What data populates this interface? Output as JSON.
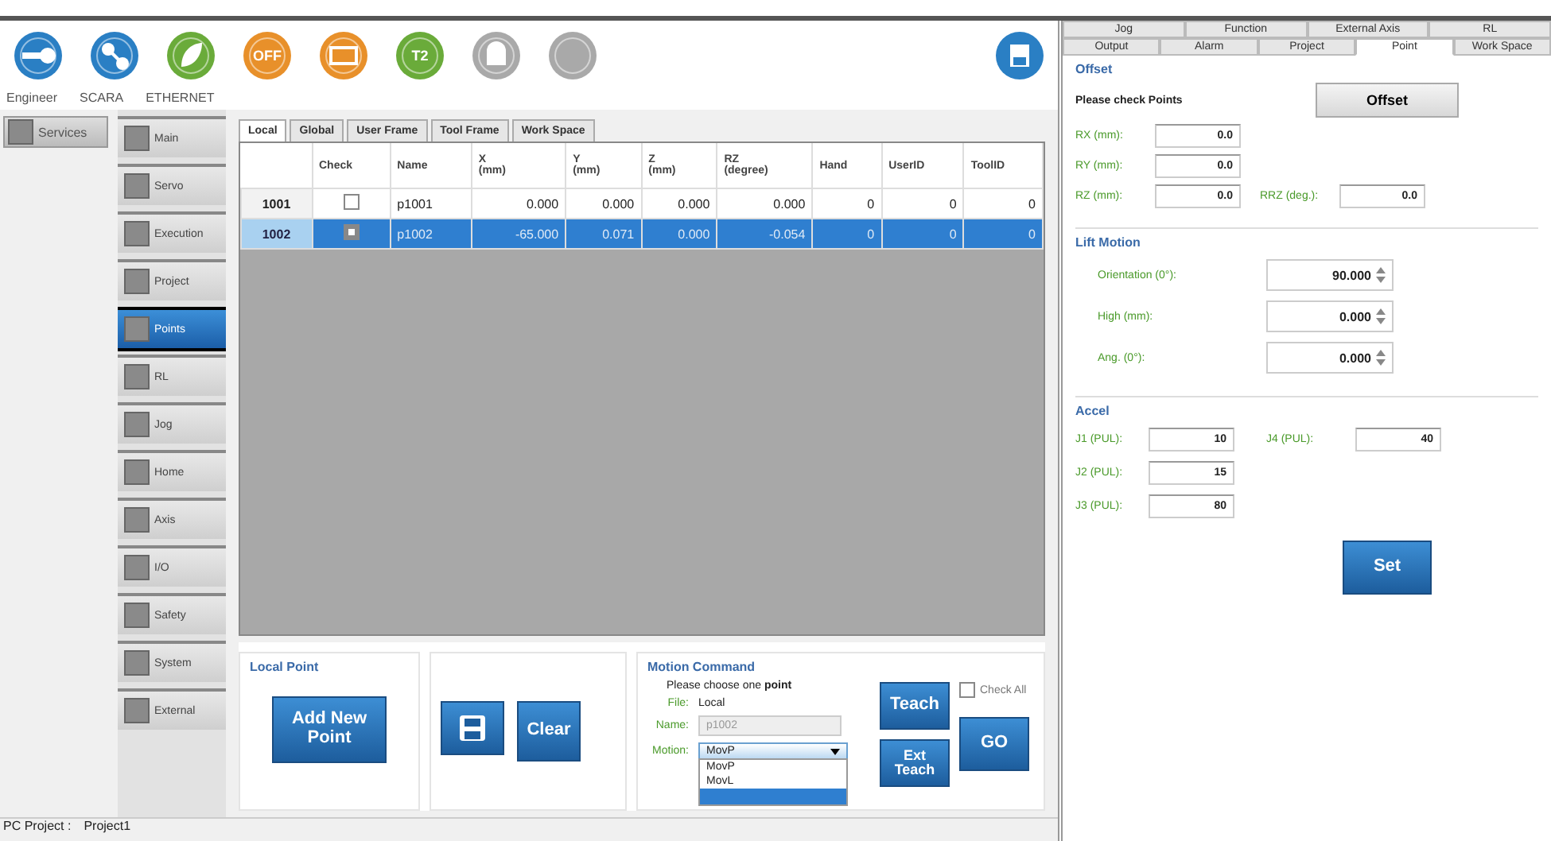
{
  "toolbar": {
    "icons": [
      {
        "kind": "key",
        "color": "#2a7fc4"
      },
      {
        "kind": "network",
        "color": "#2a7fc4"
      },
      {
        "kind": "leaf",
        "color": "#6aab3a"
      },
      {
        "kind": "text",
        "color": "#e8902a",
        "text": "OFF"
      },
      {
        "kind": "card",
        "color": "#e8902a"
      },
      {
        "kind": "text",
        "color": "#6aab3a",
        "text": "T2"
      },
      {
        "kind": "bell",
        "color": "#a9a9a9"
      },
      {
        "kind": "plain",
        "color": "#a9a9a9"
      }
    ],
    "labels": [
      "Engineer",
      "SCARA",
      "ETHERNET"
    ]
  },
  "services": "Services",
  "nav": [
    {
      "label": "Main",
      "selected": false
    },
    {
      "label": "Servo",
      "selected": false
    },
    {
      "label": "Execution",
      "selected": false
    },
    {
      "label": "Project",
      "selected": false
    },
    {
      "label": "Points",
      "selected": true
    },
    {
      "label": "RL",
      "selected": false
    },
    {
      "label": "Jog",
      "selected": false
    },
    {
      "label": "Home",
      "selected": false
    },
    {
      "label": "Axis",
      "selected": false
    },
    {
      "label": "I/O",
      "selected": false
    },
    {
      "label": "Safety",
      "selected": false
    },
    {
      "label": "System",
      "selected": false
    },
    {
      "label": "External",
      "selected": false
    }
  ],
  "tabs": [
    {
      "label": "Local",
      "selected": true
    },
    {
      "label": "Global",
      "selected": false
    },
    {
      "label": "User Frame",
      "selected": false
    },
    {
      "label": "Tool Frame",
      "selected": false
    },
    {
      "label": "Work Space",
      "selected": false
    }
  ],
  "table": {
    "columns": [
      "",
      "Check",
      "Name",
      "X\n(mm)",
      "Y\n(mm)",
      "Z\n(mm)",
      "RZ\n(degree)",
      "Hand",
      "UserID",
      "ToolID"
    ],
    "rows": [
      {
        "checked": false,
        "selected": false,
        "cells": [
          "1001",
          "",
          "p1001",
          "0.000",
          "0.000",
          "0.000",
          "0.000",
          "0",
          "0",
          "0"
        ]
      },
      {
        "checked": true,
        "selected": true,
        "cells": [
          "1002",
          "",
          "p1002",
          "-65.000",
          "0.071",
          "0.000",
          "-0.054",
          "0",
          "0",
          "0"
        ]
      }
    ]
  },
  "local_point": {
    "title": "Local Point",
    "add_button": "Add New Point",
    "clear_button": "Clear"
  },
  "motion": {
    "title": "Motion Command",
    "hint": "Please choose one **point**",
    "file_label": "File:",
    "file_value": "Local",
    "name_label": "Name:",
    "name_value": "p1002",
    "motion_label": "Motion:",
    "motion_value": "MovP",
    "options": [
      {
        "label": "MovP",
        "selected": false
      },
      {
        "label": "MovL",
        "selected": false
      }
    ],
    "teach": "Teach",
    "ext_teach": "Ext\nTeach",
    "check_all": {
      "label": "Check All",
      "checked": false
    },
    "go": "GO"
  },
  "status_bar": [
    "PC Project :",
    "Project1"
  ],
  "right": {
    "tabs_back": [
      "Jog",
      "Function",
      "External Axis",
      "RL"
    ],
    "tabs": [
      {
        "label": "Output",
        "selected": false
      },
      {
        "label": "Alarm",
        "selected": false
      },
      {
        "label": "Project",
        "selected": false
      },
      {
        "label": "Point",
        "selected": true
      },
      {
        "label": "Work Space",
        "selected": false
      }
    ],
    "offset": {
      "title": "Offset",
      "hint": "Please check Points",
      "button": "Offset",
      "fields": [
        {
          "label": "RX (mm):",
          "value": "0.0"
        },
        {
          "label": "RY (mm):",
          "value": "0.0"
        },
        {
          "label": "RZ (mm):",
          "value": "0.0"
        },
        {
          "label": "RRZ (deg.):",
          "value": "0.0"
        }
      ]
    },
    "lift": {
      "title": "Lift Motion",
      "fields": [
        {
          "label": "Orientation (0°):",
          "value": "90.000"
        },
        {
          "label": "High (mm):",
          "value": "0.000"
        },
        {
          "label": "Ang. (0°):",
          "value": "0.000"
        }
      ]
    },
    "accel": {
      "title": "Accel",
      "fields": [
        {
          "label": "J1 (PUL):",
          "value": "10"
        },
        {
          "label": "J4 (PUL):",
          "value": "40"
        },
        {
          "label": "J2 (PUL):",
          "value": "15"
        },
        {
          "label": "J3 (PUL):",
          "value": "80"
        }
      ]
    },
    "set_button": "Set"
  }
}
